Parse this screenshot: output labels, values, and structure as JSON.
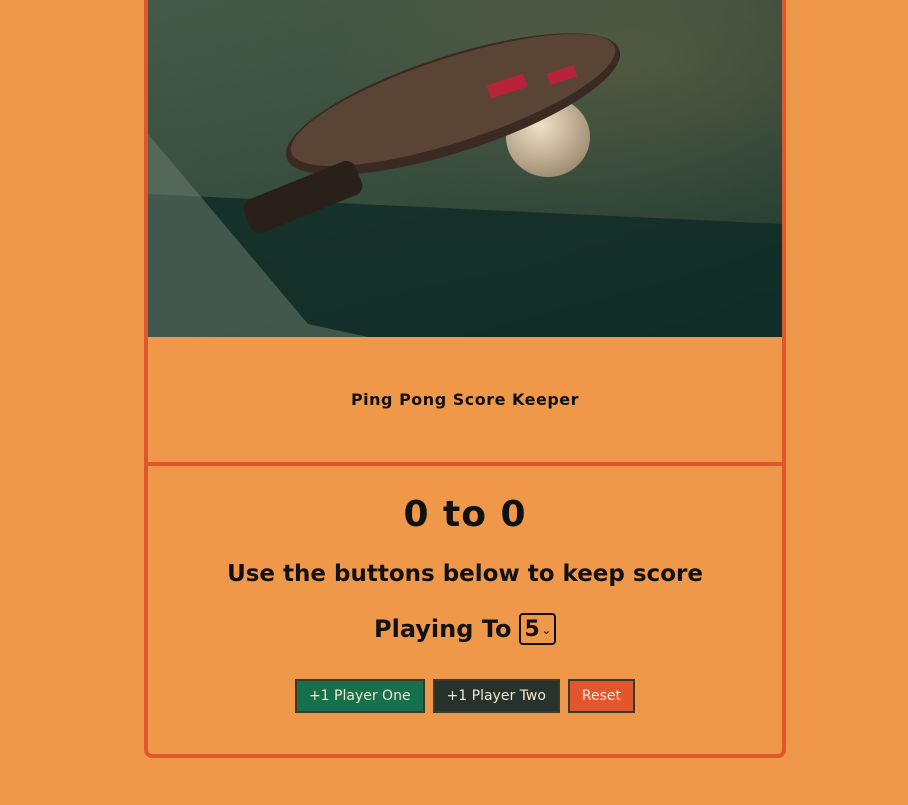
{
  "app": {
    "title": "Ping Pong Score Keeper",
    "image_alt": "Ping pong paddle resting on a table with a ball"
  },
  "score": {
    "player_one": "0",
    "separator": "to",
    "player_two": "0",
    "display": "0 to 0"
  },
  "instructions": "Use the buttons below to keep score",
  "playing_to": {
    "label": "Playing To",
    "selected": "5"
  },
  "buttons": {
    "player_one": "+1 Player One",
    "player_two": "+1 Player Two",
    "reset": "Reset"
  },
  "colors": {
    "background": "#f0984a",
    "border": "#e2562e",
    "player_one_button": "#16704c",
    "player_two_button": "#27322d",
    "reset_button": "#e2562e"
  }
}
